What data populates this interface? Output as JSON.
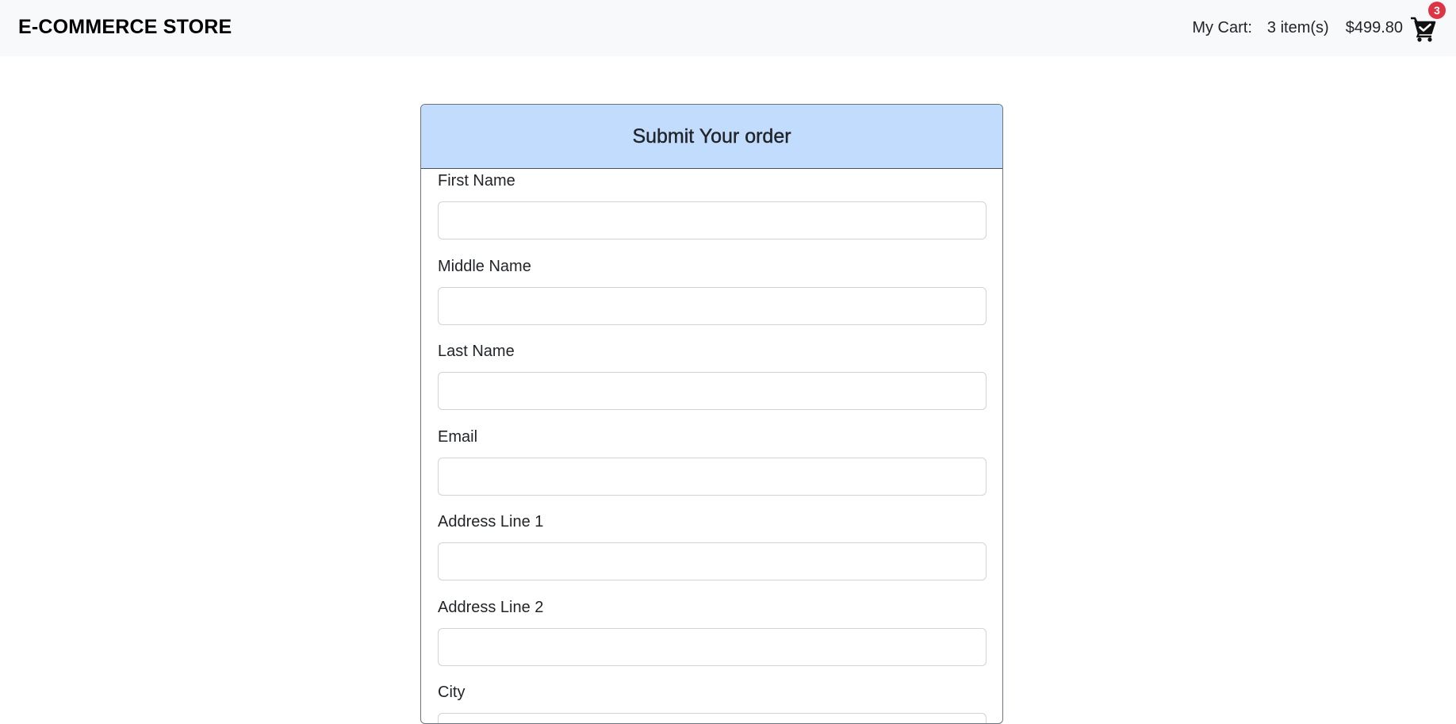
{
  "navbar": {
    "brand": "E-COMMERCE STORE",
    "cart_label": "My Cart:",
    "cart_items": "3 item(s)",
    "cart_total": "$499.80",
    "cart_badge": "3",
    "cart_icon": "shopping-cart-check-icon",
    "badge_color": "#dc3545"
  },
  "form": {
    "title": "Submit Your order",
    "header_color": "#c2dcfe",
    "fields": [
      {
        "label": "First Name",
        "value": "",
        "placeholder": ""
      },
      {
        "label": "Middle Name",
        "value": "",
        "placeholder": ""
      },
      {
        "label": "Last Name",
        "value": "",
        "placeholder": ""
      },
      {
        "label": "Email",
        "value": "",
        "placeholder": ""
      },
      {
        "label": "Address Line 1",
        "value": "",
        "placeholder": ""
      },
      {
        "label": "Address Line 2",
        "value": "",
        "placeholder": ""
      },
      {
        "label": "City",
        "value": "",
        "placeholder": ""
      }
    ]
  }
}
